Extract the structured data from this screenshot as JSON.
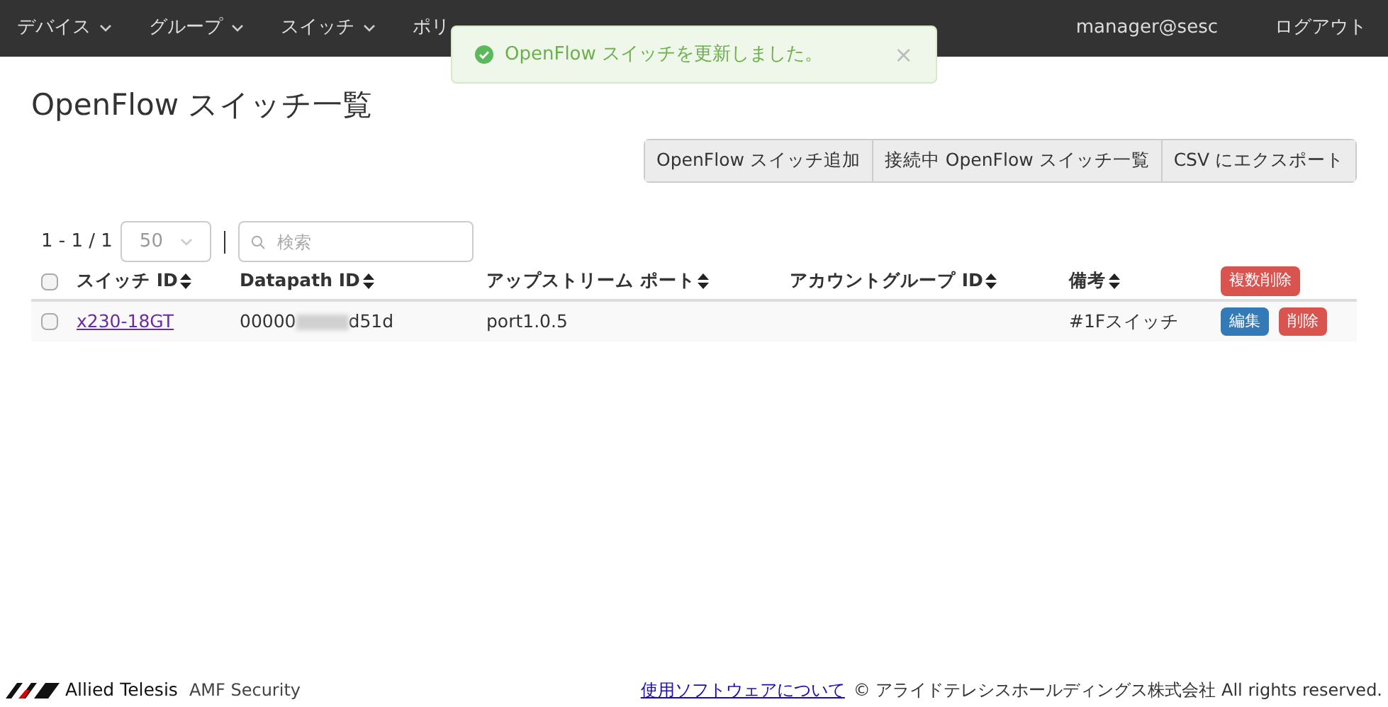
{
  "nav": {
    "items": [
      {
        "label": "デバイス",
        "dropdown": true
      },
      {
        "label": "グループ",
        "dropdown": true
      },
      {
        "label": "スイッチ",
        "dropdown": true
      },
      {
        "label": "ポリ",
        "dropdown": false
      }
    ],
    "user": "manager@sesc",
    "logout": "ログアウト"
  },
  "toast": {
    "message": "OpenFlow スイッチを更新しました。",
    "close": "×"
  },
  "title": "OpenFlow スイッチ一覧",
  "actions": [
    "OpenFlow スイッチ追加",
    "接続中 OpenFlow スイッチ一覧",
    "CSV にエクスポート"
  ],
  "pager": {
    "range": "1 - 1 / 1",
    "per_page": "50",
    "search_placeholder": "検索"
  },
  "table": {
    "columns": [
      "スイッチ ID",
      "Datapath ID",
      "アップストリーム ポート",
      "アカウントグループ ID",
      "備考"
    ],
    "bulk_delete": "複数削除",
    "select_all_checked": false,
    "rows": [
      {
        "checked": false,
        "switch_id": "x230-18GT",
        "datapath_start": "00000",
        "datapath_end": "d51d",
        "redacted": true,
        "port": "port1.0.5",
        "note": "#1Fスイッチ",
        "edit": "編集",
        "delete": "削除"
      }
    ]
  },
  "footer": {
    "brand": "Allied Telesis",
    "product": "AMF Security",
    "link": "使用ソフトウェアについて",
    "copyright": "© アライドテレシスホールディングス株式会社 All rights reserved."
  }
}
